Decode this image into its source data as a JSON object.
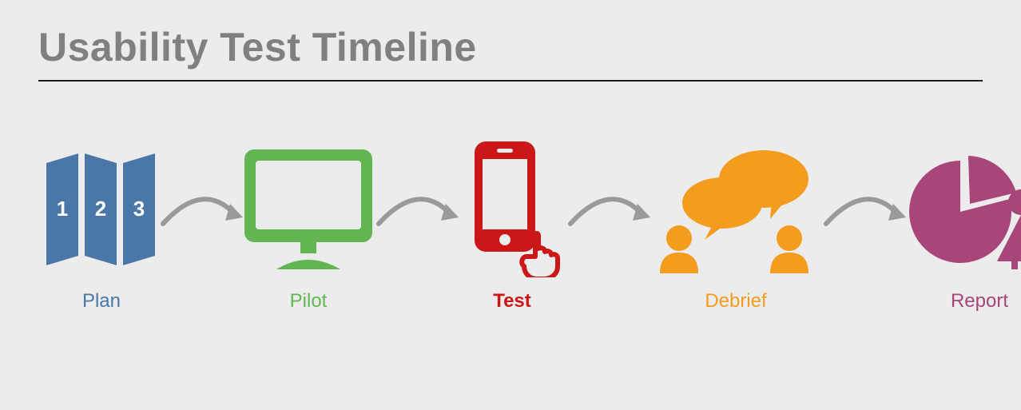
{
  "title": "Usability Test Timeline",
  "steps": [
    {
      "label": "Plan",
      "icon": "map-icon",
      "color": "#4b77a8",
      "numbers": [
        "1",
        "2",
        "3"
      ]
    },
    {
      "label": "Pilot",
      "icon": "monitor-icon",
      "color": "#61b651"
    },
    {
      "label": "Test",
      "icon": "phone-touch-icon",
      "color": "#cc1718"
    },
    {
      "label": "Debrief",
      "icon": "discussion-icon",
      "color": "#f49c1d"
    },
    {
      "label": "Report",
      "icon": "pie-person-icon",
      "color": "#a84579"
    }
  ],
  "arrow_color": "#9a9a9a"
}
